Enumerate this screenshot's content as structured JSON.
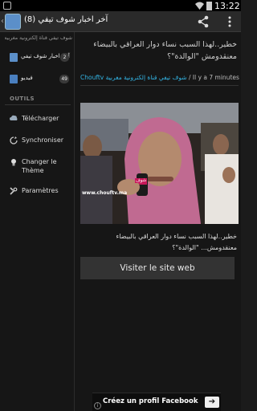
{
  "status_bar": {
    "time": "13:22"
  },
  "action_bar": {
    "title": "آخر اخبار شوف تيفي (8)",
    "icons": [
      "app-icon",
      "share-icon",
      "overflow-icon"
    ]
  },
  "drawer": {
    "subtitle": "شوف تيفي قناة إلكترونية مغربية",
    "feeds": [
      {
        "label": "آخر اخبار شوف تيفي",
        "count": "2",
        "icon": "rss-feed-icon"
      },
      {
        "label": "فيديو",
        "count": "49",
        "icon": "rss-feed-icon"
      }
    ],
    "section_label": "OUTILS",
    "tools": [
      {
        "label": "Télécharger",
        "icon": "download-icon"
      },
      {
        "label": "Synchroniser",
        "icon": "sync-icon"
      },
      {
        "label": "Changer le Thème",
        "icon": "theme-icon"
      },
      {
        "label": "Paramètres",
        "icon": "settings-icon"
      }
    ]
  },
  "article": {
    "headline": "خطير..لهذا السبب نساء دوار العراقي بالبيضاء معنقدومش \"الوالدة\"؟",
    "source": "Chouftv شوف تيفي قناة إلكترونية مغربية",
    "separator": "/",
    "time_ago": "Il y a 7 minutes",
    "video_watermark": "www.chouftv.ma",
    "video_logo": "شوف",
    "caption": "خطير..لهذا السبب نساء دوار العراقي بالبيضاء معنقدومش... \"الوالدة\"؟",
    "visit_button": "Visiter le site web"
  },
  "ad_banner": {
    "label": "Créez un profil Facebook",
    "arrow": "➔",
    "info": "i"
  },
  "colors": {
    "background": "#161616",
    "accent_blue": "#33b5e5",
    "button_gray": "#333333"
  }
}
